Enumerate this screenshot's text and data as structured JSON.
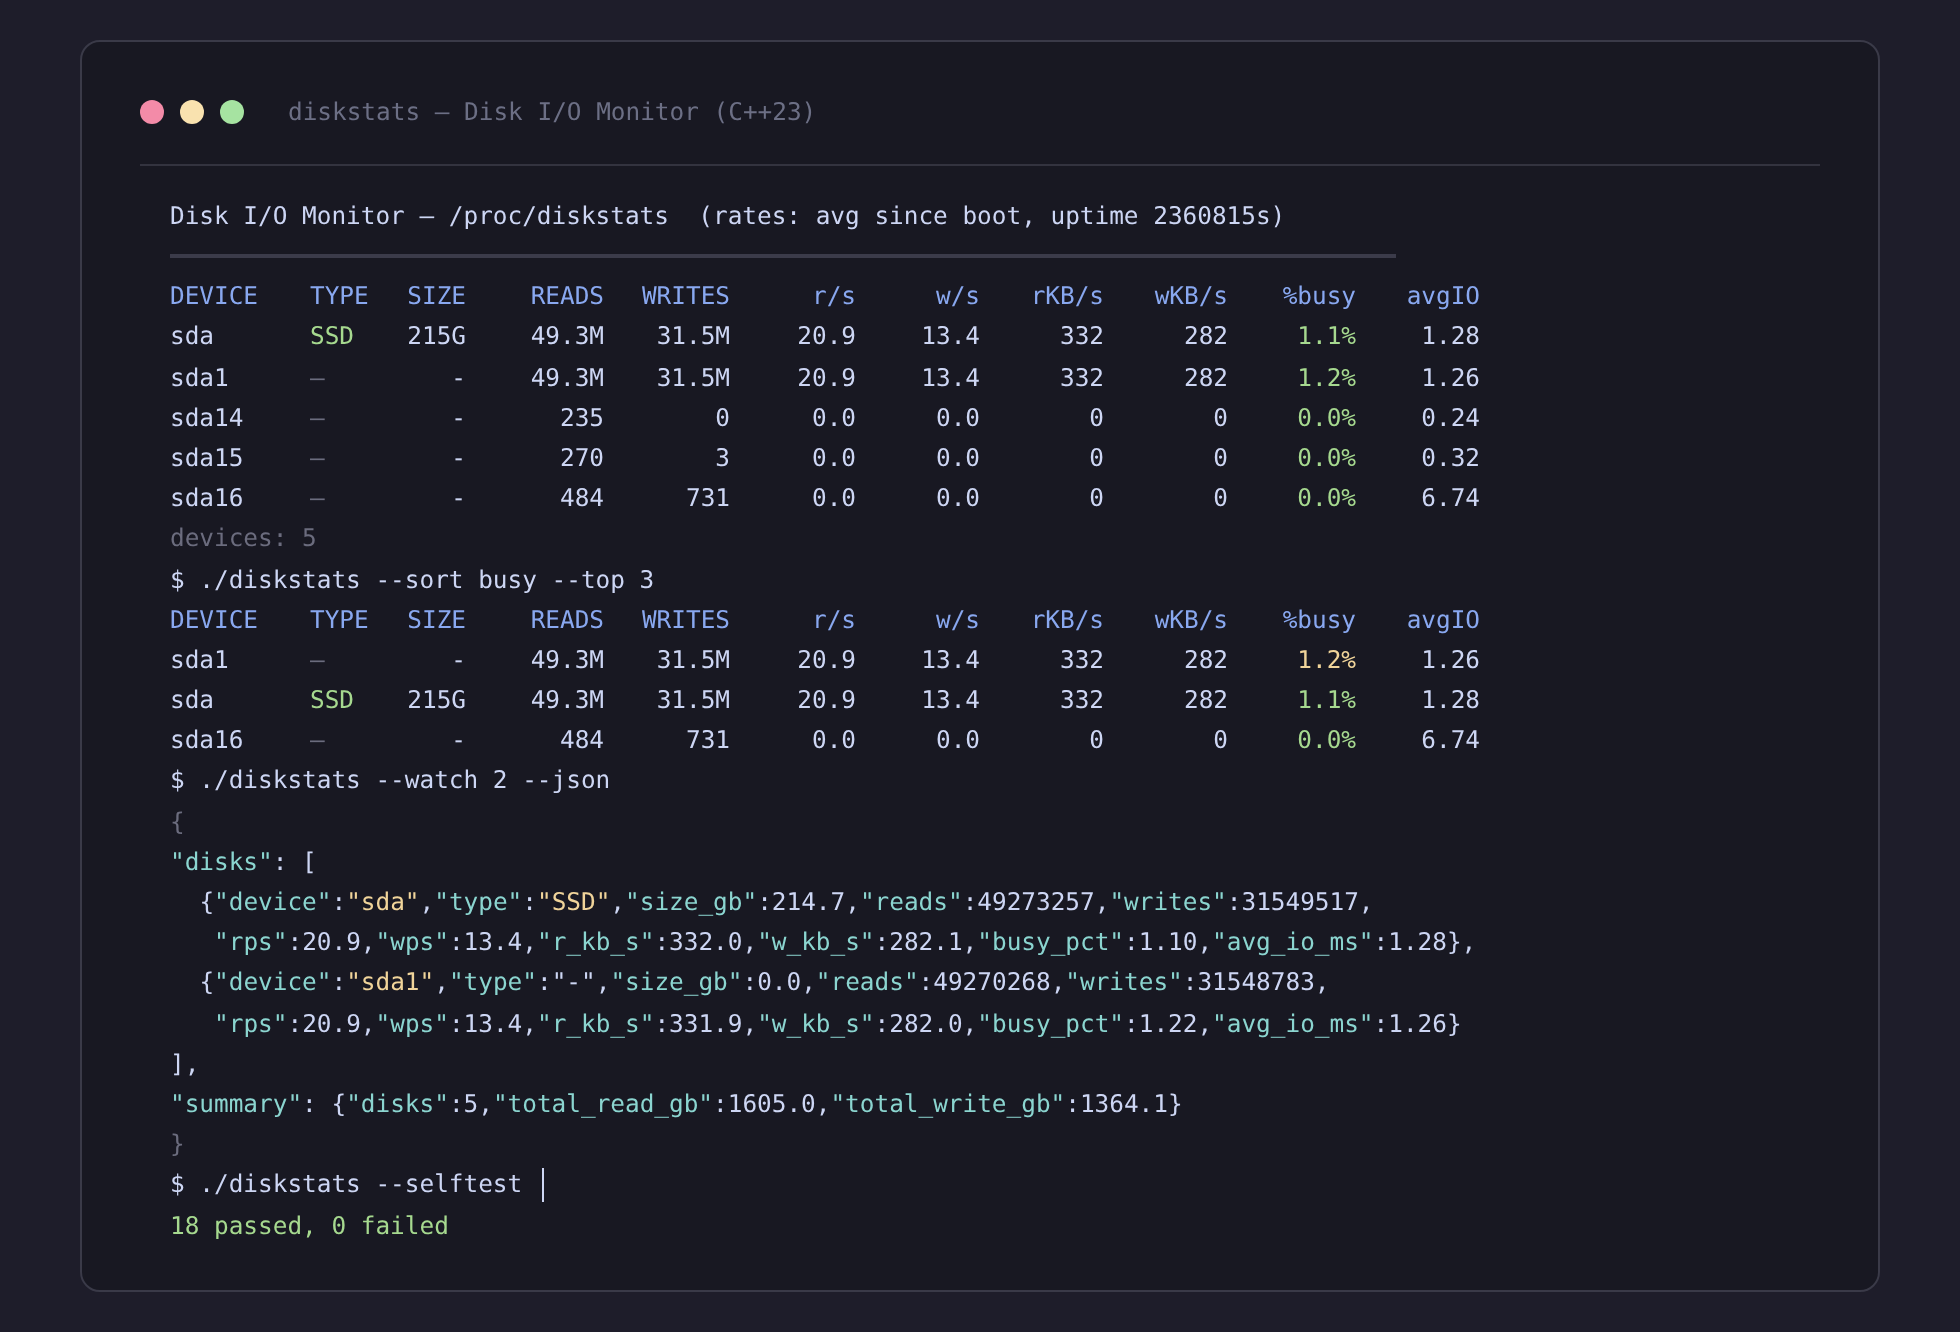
{
  "window": {
    "title": "diskstats — Disk I/O Monitor (C++23)"
  },
  "terminal": {
    "blocks": [
      {
        "kind": "heading",
        "text": "Disk I/O Monitor — /proc/diskstats  (rates: avg since boot, uptime 2360815s)"
      },
      {
        "kind": "table",
        "columns": [
          "DEVICE",
          "TYPE",
          "SIZE",
          "READS",
          "WRITES",
          "r/s",
          "w/s",
          "rKB/s",
          "wKB/s",
          "%busy",
          "avgIO"
        ],
        "rows": [
          {
            "kind": "disk",
            "highlighted": false,
            "cells": [
              "sda",
              "SSD",
              "215G",
              "49.3M",
              "31.5M",
              "20.9",
              "13.4",
              "332",
              "282",
              "1.1%",
              "1.28"
            ]
          },
          {
            "kind": "partition",
            "highlighted": false,
            "cells": [
              "sda1",
              "–",
              "-",
              "49.3M",
              "31.5M",
              "20.9",
              "13.4",
              "332",
              "282",
              "1.2%",
              "1.26"
            ]
          },
          {
            "kind": "partition",
            "highlighted": false,
            "cells": [
              "sda14",
              "–",
              "-",
              "235",
              "0",
              "0.0",
              "0.0",
              "0",
              "0",
              "0.0%",
              "0.24"
            ]
          },
          {
            "kind": "partition",
            "highlighted": false,
            "cells": [
              "sda15",
              "–",
              "-",
              "270",
              "3",
              "0.0",
              "0.0",
              "0",
              "0",
              "0.0%",
              "0.32"
            ]
          },
          {
            "kind": "partition",
            "highlighted": false,
            "cells": [
              "sda16",
              "–",
              "-",
              "484",
              "731",
              "0.0",
              "0.0",
              "0",
              "0",
              "0.0%",
              "6.74"
            ]
          }
        ]
      },
      {
        "kind": "note",
        "text": "devices: 5"
      },
      {
        "kind": "prompt",
        "text": "$ ./diskstats --sort busy --top 3"
      },
      {
        "kind": "table",
        "columns": [
          "DEVICE",
          "TYPE",
          "SIZE",
          "READS",
          "WRITES",
          "r/s",
          "w/s",
          "rKB/s",
          "wKB/s",
          "%busy",
          "avgIO"
        ],
        "rows": [
          {
            "kind": "partition",
            "highlighted": true,
            "cells": [
              "sda1",
              "–",
              "-",
              "49.3M",
              "31.5M",
              "20.9",
              "13.4",
              "332",
              "282",
              "1.2%",
              "1.26"
            ]
          },
          {
            "kind": "disk",
            "highlighted": false,
            "cells": [
              "sda",
              "SSD",
              "215G",
              "49.3M",
              "31.5M",
              "20.9",
              "13.4",
              "332",
              "282",
              "1.1%",
              "1.28"
            ]
          },
          {
            "kind": "partition",
            "highlighted": false,
            "cells": [
              "sda16",
              "–",
              "-",
              "484",
              "731",
              "0.0",
              "0.0",
              "0",
              "0",
              "0.0%",
              "6.74"
            ]
          }
        ]
      },
      {
        "kind": "prompt",
        "text": "$ ./diskstats --watch 2 --json"
      },
      {
        "kind": "json",
        "lines": [
          {
            "kind": "top",
            "tokens": [
              {
                "text": "{",
                "kind": "dim"
              }
            ]
          },
          {
            "kind": "top",
            "tokens": [
              {
                "text": "\"disks\"",
                "kind": "key"
              },
              {
                "text": ": [",
                "kind": "plain"
              }
            ]
          },
          {
            "kind": "item",
            "tokens": [
              {
                "text": "{",
                "kind": "plain"
              },
              {
                "text": "\"device\"",
                "kind": "key"
              },
              {
                "text": ":",
                "kind": "plain"
              },
              {
                "text": "\"sda\"",
                "kind": "str"
              },
              {
                "text": ",",
                "kind": "plain"
              },
              {
                "text": "\"type\"",
                "kind": "key"
              },
              {
                "text": ":",
                "kind": "plain"
              },
              {
                "text": "\"SSD\"",
                "kind": "str"
              },
              {
                "text": ",",
                "kind": "plain"
              },
              {
                "text": "\"size_gb\"",
                "kind": "key"
              },
              {
                "text": ":214.7,",
                "kind": "plain"
              },
              {
                "text": "\"reads\"",
                "kind": "key"
              },
              {
                "text": ":49273257,",
                "kind": "plain"
              },
              {
                "text": "\"writes\"",
                "kind": "key"
              },
              {
                "text": ":31549517,",
                "kind": "plain"
              }
            ]
          },
          {
            "kind": "cont",
            "tokens": [
              {
                "text": "\"rps\"",
                "kind": "key"
              },
              {
                "text": ":20.9,",
                "kind": "plain"
              },
              {
                "text": "\"wps\"",
                "kind": "key"
              },
              {
                "text": ":13.4,",
                "kind": "plain"
              },
              {
                "text": "\"r_kb_s\"",
                "kind": "key"
              },
              {
                "text": ":332.0,",
                "kind": "plain"
              },
              {
                "text": "\"w_kb_s\"",
                "kind": "key"
              },
              {
                "text": ":282.1,",
                "kind": "plain"
              },
              {
                "text": "\"busy_pct\"",
                "kind": "key"
              },
              {
                "text": ":1.10,",
                "kind": "plain"
              },
              {
                "text": "\"avg_io_ms\"",
                "kind": "key"
              },
              {
                "text": ":1.28},",
                "kind": "plain"
              }
            ]
          },
          {
            "kind": "item",
            "tokens": [
              {
                "text": "{",
                "kind": "plain"
              },
              {
                "text": "\"device\"",
                "kind": "key"
              },
              {
                "text": ":",
                "kind": "plain"
              },
              {
                "text": "\"sda1\"",
                "kind": "str"
              },
              {
                "text": ",",
                "kind": "plain"
              },
              {
                "text": "\"type\"",
                "kind": "key"
              },
              {
                "text": ":",
                "kind": "plain"
              },
              {
                "text": "\"-\"",
                "kind": "plain"
              },
              {
                "text": ",",
                "kind": "plain"
              },
              {
                "text": "\"size_gb\"",
                "kind": "key"
              },
              {
                "text": ":0.0,",
                "kind": "plain"
              },
              {
                "text": "\"reads\"",
                "kind": "key"
              },
              {
                "text": ":49270268,",
                "kind": "plain"
              },
              {
                "text": "\"writes\"",
                "kind": "key"
              },
              {
                "text": ":31548783,",
                "kind": "plain"
              }
            ]
          },
          {
            "kind": "cont",
            "tokens": [
              {
                "text": "\"rps\"",
                "kind": "key"
              },
              {
                "text": ":20.9,",
                "kind": "plain"
              },
              {
                "text": "\"wps\"",
                "kind": "key"
              },
              {
                "text": ":13.4,",
                "kind": "plain"
              },
              {
                "text": "\"r_kb_s\"",
                "kind": "key"
              },
              {
                "text": ":331.9,",
                "kind": "plain"
              },
              {
                "text": "\"w_kb_s\"",
                "kind": "key"
              },
              {
                "text": ":282.0,",
                "kind": "plain"
              },
              {
                "text": "\"busy_pct\"",
                "kind": "key"
              },
              {
                "text": ":1.22,",
                "kind": "plain"
              },
              {
                "text": "\"avg_io_ms\"",
                "kind": "key"
              },
              {
                "text": ":1.26}",
                "kind": "plain"
              }
            ]
          },
          {
            "kind": "top",
            "tokens": [
              {
                "text": "],",
                "kind": "plain"
              }
            ]
          },
          {
            "kind": "top",
            "tokens": [
              {
                "text": "\"summary\"",
                "kind": "key"
              },
              {
                "text": ": {",
                "kind": "plain"
              },
              {
                "text": "\"disks\"",
                "kind": "key"
              },
              {
                "text": ":5,",
                "kind": "plain"
              },
              {
                "text": "\"total_read_gb\"",
                "kind": "key"
              },
              {
                "text": ":1605.0,",
                "kind": "plain"
              },
              {
                "text": "\"total_write_gb\"",
                "kind": "key"
              },
              {
                "text": ":1364.1}",
                "kind": "plain"
              }
            ]
          },
          {
            "kind": "top",
            "tokens": [
              {
                "text": "}",
                "kind": "dim"
              }
            ]
          }
        ]
      },
      {
        "kind": "prompt",
        "text": "$ ./diskstats --selftest",
        "cursor": true
      },
      {
        "kind": "result",
        "text": "18 passed, 0 failed"
      }
    ]
  }
}
